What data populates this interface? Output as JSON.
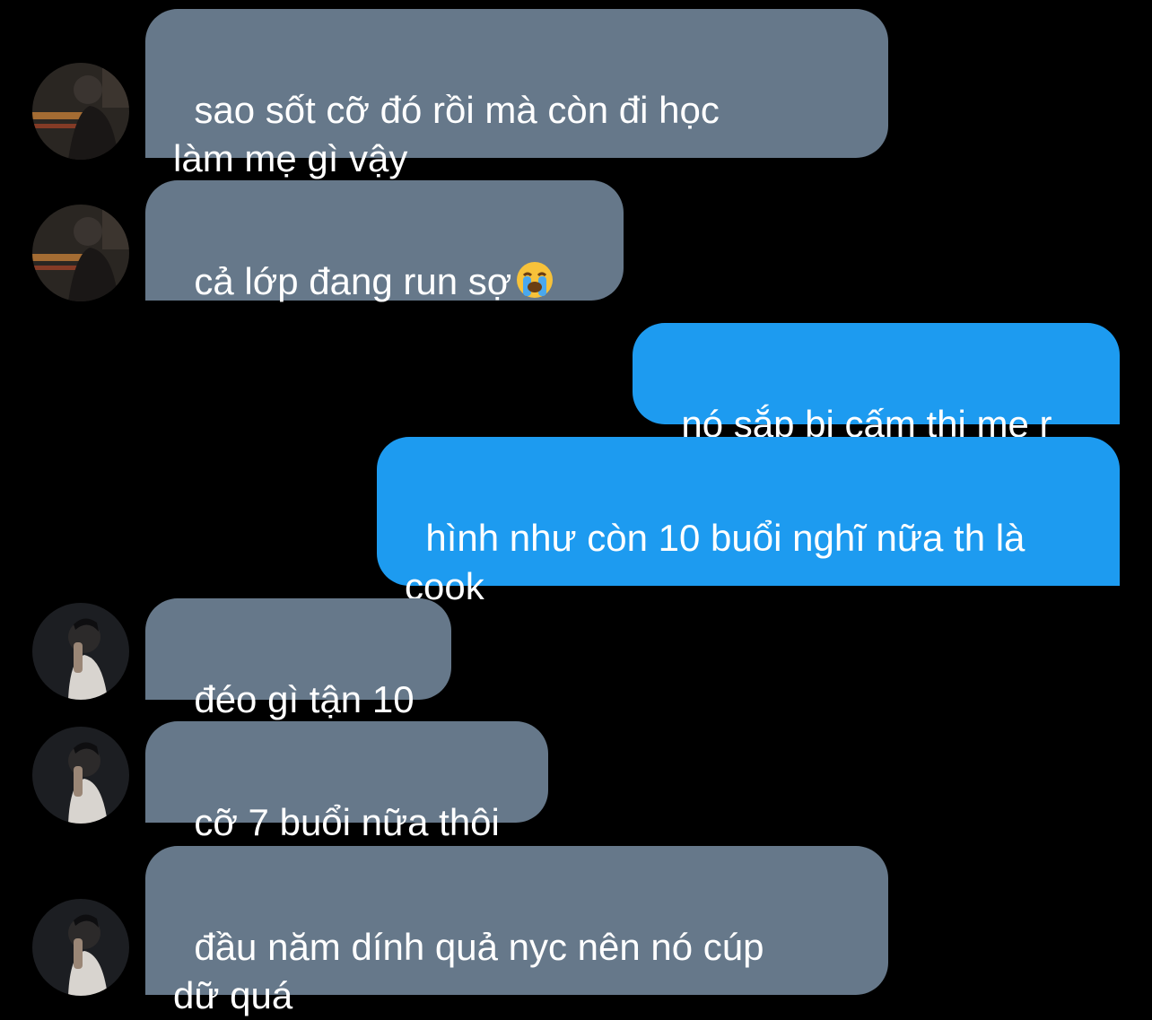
{
  "conversation": {
    "messages": [
      {
        "sender": "them",
        "text": "sao sốt cỡ đó rồi mà còn đi học\nlàm mẹ gì vậy"
      },
      {
        "sender": "them",
        "text": "cả lớp đang run sợ",
        "emoji": "loudly-crying-face"
      },
      {
        "sender": "me",
        "text": "nó sắp bị cấm thi mẹ r"
      },
      {
        "sender": "me",
        "text": "hình như còn 10 buổi nghĩ nữa th là\ncook"
      },
      {
        "sender": "them",
        "text": "đéo gì tận 10"
      },
      {
        "sender": "them",
        "text": "cỡ 7 buổi nữa thôi"
      },
      {
        "sender": "them",
        "text": "đầu năm dính quả nyc nên nó cúp\ndữ quá"
      }
    ]
  },
  "colors": {
    "background": "#000000",
    "incoming_bubble": "#66788a",
    "outgoing_bubble": "#1d9bf0",
    "text": "#ffffff"
  }
}
